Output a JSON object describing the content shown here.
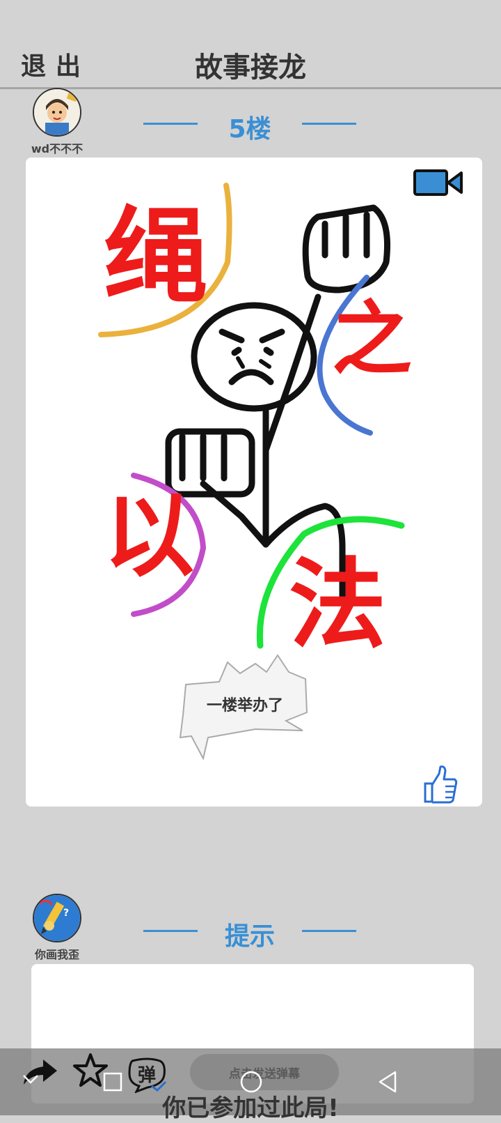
{
  "header": {
    "exit_label": "退出",
    "title": "故事接龙"
  },
  "post1": {
    "author": "wd不不不",
    "floor_label": "5楼",
    "caption": "一楼举办了",
    "drawing_words": [
      "绳",
      "之",
      "以",
      "法"
    ]
  },
  "post2": {
    "author": "你画我歪",
    "section_label": "提示"
  },
  "footer": {
    "send_placeholder": "点击发送弹幕",
    "danmu_label": "弹",
    "joined_text": "你已参加过此局!"
  },
  "colors": {
    "accent": "#3a8fd4",
    "background": "#d3d3d3"
  },
  "icons": [
    "video-camera-icon",
    "thumbs-up-icon",
    "share-icon",
    "star-icon",
    "nav-home-icon",
    "nav-back-icon",
    "nav-recents-icon",
    "nav-down-icon"
  ]
}
